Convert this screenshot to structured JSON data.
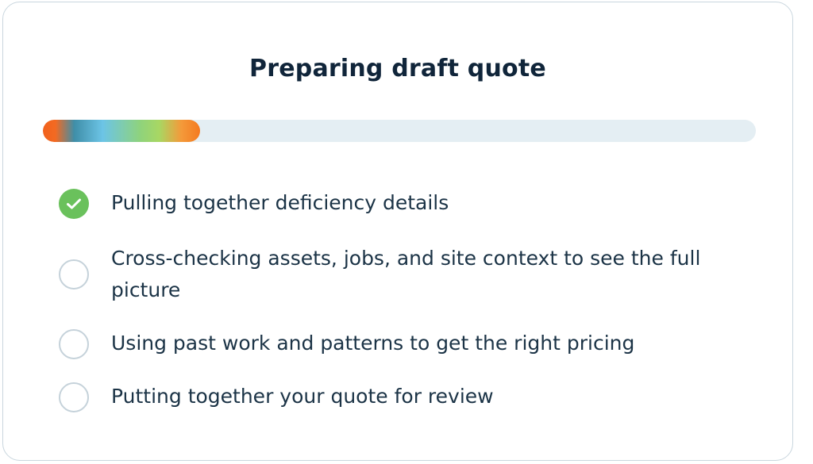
{
  "title": "Preparing draft quote",
  "progress": {
    "fraction": 0.22
  },
  "steps": [
    {
      "label": "Pulling together deficiency details",
      "status": "completed",
      "icon": "check-circle-icon",
      "color": "#6ac15c"
    },
    {
      "label": "Cross-checking assets, jobs, and site context to see the full picture",
      "status": "pending",
      "icon": "empty-circle-icon"
    },
    {
      "label": "Using past work and patterns to get the right pricing",
      "status": "pending",
      "icon": "empty-circle-icon"
    },
    {
      "label": "Putting together your quote for review",
      "status": "pending",
      "icon": "empty-circle-icon"
    }
  ]
}
